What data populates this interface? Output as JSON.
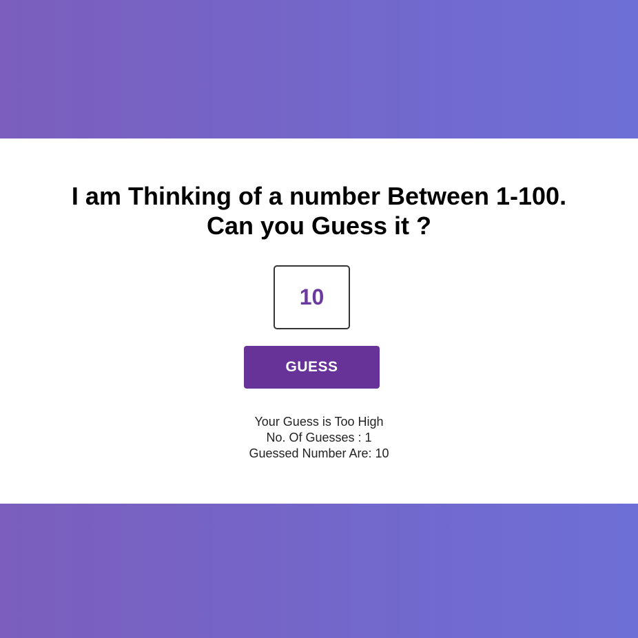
{
  "game": {
    "title_line1": "I am Thinking of a number Between 1-100.",
    "title_line2": "Can you Guess it ?",
    "input_value": "10",
    "guess_button_label": "GUESS",
    "result_message": "Your Guess is Too High",
    "guess_count_text": "No. Of Guesses : 1",
    "guessed_numbers_text": "Guessed Number Are: 10"
  },
  "colors": {
    "gradient_start": "#7b5ebd",
    "gradient_end": "#6d6fd6",
    "accent": "#673399",
    "input_text": "#6a3a9e"
  }
}
